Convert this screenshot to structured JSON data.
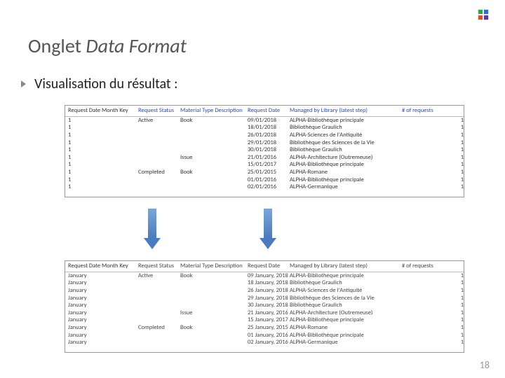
{
  "title_plain": "Onglet ",
  "title_em": "Data Format",
  "bullet": "Visualisation du résultat :",
  "page_number": "18",
  "table1": {
    "headers": [
      "Request Date Month Key",
      "Request Status",
      "Material Type Description",
      "Request Date",
      "Managed by Library (latest step)",
      "# of requests"
    ],
    "rows": [
      [
        "1",
        "Active",
        "Book",
        "09/01/2018",
        "ALPHA-Bibliothèque principale",
        "1"
      ],
      [
        "1",
        "",
        "",
        "18/01/2018",
        "Bibliothèque Graulich",
        "1"
      ],
      [
        "1",
        "",
        "",
        "26/01/2018",
        "ALPHA-Sciences de l'Antiquité",
        "1"
      ],
      [
        "1",
        "",
        "",
        "29/01/2018",
        "Bibliothèque des Sciences de la Vie",
        "1"
      ],
      [
        "1",
        "",
        "",
        "30/01/2018",
        "Bibliothèque Graulich",
        "1"
      ],
      [
        "1",
        "",
        "Issue",
        "21/01/2016",
        "ALPHA-Architecture (Outremeuse)",
        "1"
      ],
      [
        "1",
        "",
        "",
        "15/01/2017",
        "ALPHA-Bibliothèque principale",
        "1"
      ],
      [
        "1",
        "Completed",
        "Book",
        "25/01/2015",
        "ALPHA-Romane",
        "1"
      ],
      [
        "1",
        "",
        "",
        "01/01/2016",
        "ALPHA-Bibliothèque principale",
        "1"
      ],
      [
        "1",
        "",
        "",
        "02/01/2016",
        "ALPHA-Germanique",
        "1"
      ]
    ]
  },
  "table2": {
    "headers": [
      "Request Date Month Key",
      "Request Status",
      "Material Type Description",
      "Request Date",
      "Managed by Library (latest step)",
      "# of requests"
    ],
    "rows": [
      [
        "January",
        "Active",
        "Book",
        "09 January, 2018",
        "ALPHA-Bibliothèque principale",
        "1"
      ],
      [
        "January",
        "",
        "",
        "18 January, 2018",
        "Bibliothèque Graulich",
        "1"
      ],
      [
        "January",
        "",
        "",
        "26 January, 2018",
        "ALPHA-Sciences de l'Antiquité",
        "1"
      ],
      [
        "January",
        "",
        "",
        "29 January, 2018",
        "Bibliothèque des Sciences de la Vie",
        "1"
      ],
      [
        "January",
        "",
        "",
        "30 January, 2018",
        "Bibliothèque Graulich",
        "1"
      ],
      [
        "January",
        "",
        "Issue",
        "21 January, 2016",
        "ALPHA-Architecture (Outremeuse)",
        "1"
      ],
      [
        "January",
        "",
        "",
        "15 January, 2017",
        "ALPHA-Bibliothèque principale",
        "1"
      ],
      [
        "January",
        "Completed",
        "Book",
        "25 January, 2015",
        "ALPHA-Romane",
        "1"
      ],
      [
        "January",
        "",
        "",
        "01 January, 2016",
        "ALPHA-Bibliothèque principale",
        "1"
      ],
      [
        "January",
        "",
        "",
        "02 January, 2016",
        "ALPHA-Germanique",
        "1"
      ]
    ]
  }
}
